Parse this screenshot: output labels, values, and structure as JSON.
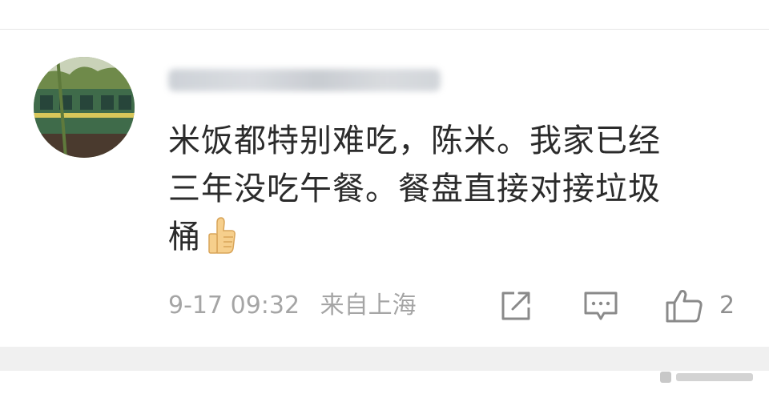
{
  "comment": {
    "avatar_icon": "train-photo-avatar",
    "username": "",
    "text_lines": [
      "米饭都特别难吃，陈米。我家已经",
      "三年没吃午餐。餐盘直接对接垃圾",
      "桶"
    ],
    "emoji": "thumbs-up",
    "timestamp": "9-17 09:32",
    "location": "来自上海",
    "actions": {
      "share_icon": "share-icon",
      "reply_icon": "comment-icon",
      "like_icon": "thumbs-up-icon",
      "like_count": "2"
    }
  },
  "colors": {
    "text": "#2b2b2b",
    "meta": "#a5a5a5",
    "divider": "#e6e6e6",
    "band": "#f0f0f0"
  }
}
